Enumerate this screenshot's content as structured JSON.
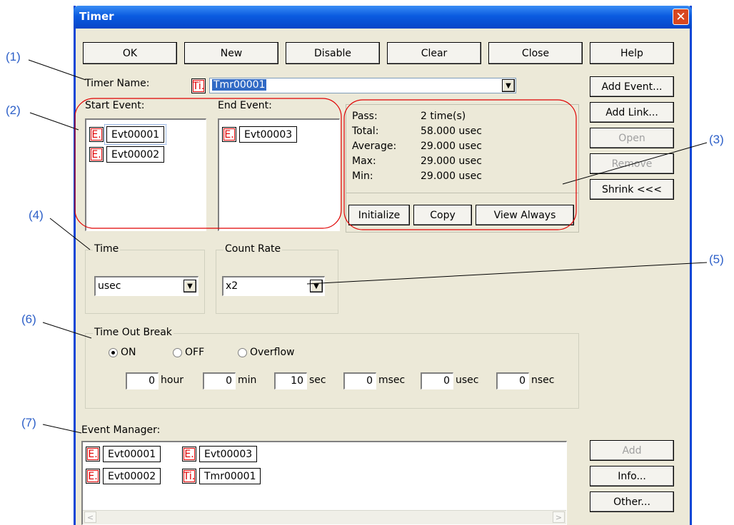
{
  "callouts": [
    "(1)",
    "(2)",
    "(3)",
    "(4)",
    "(5)",
    "(6)",
    "(7)"
  ],
  "window": {
    "title": "Timer"
  },
  "toolbar": {
    "ok": "OK",
    "new": "New",
    "disable": "Disable",
    "clear": "Clear",
    "close": "Close",
    "help": "Help"
  },
  "side_buttons": {
    "add_event": "Add Event...",
    "add_link": "Add Link...",
    "open": "Open",
    "remove": "Remove",
    "shrink": "Shrink <<<"
  },
  "timer_name": {
    "label": "Timer Name:",
    "badge": "Ti.",
    "value": "Tmr00001"
  },
  "start_event": {
    "label": "Start Event:",
    "items": [
      {
        "badge": "E.",
        "name": "Evt00001"
      },
      {
        "badge": "E.",
        "name": "Evt00002"
      }
    ]
  },
  "end_event": {
    "label": "End Event:",
    "items": [
      {
        "badge": "E.",
        "name": "Evt00003"
      }
    ]
  },
  "stats": {
    "pass_label": "Pass:",
    "pass_value": "2 time(s)",
    "total_label": "Total:",
    "total_value": "58.000 usec",
    "average_label": "Average:",
    "average_value": "29.000 usec",
    "max_label": "Max:",
    "max_value": "29.000 usec",
    "min_label": "Min:",
    "min_value": "29.000 usec",
    "initialize": "Initialize",
    "copy": "Copy",
    "view_always": "View Always"
  },
  "time_group": {
    "title": "Time",
    "value": "usec"
  },
  "count_rate": {
    "title": "Count Rate",
    "value": "x2"
  },
  "timeout": {
    "title": "Time Out Break",
    "options": [
      "ON",
      "OFF",
      "Overflow"
    ],
    "selected": "ON",
    "fields": [
      {
        "value": "0",
        "unit": "hour"
      },
      {
        "value": "0",
        "unit": "min"
      },
      {
        "value": "10",
        "unit": "sec"
      },
      {
        "value": "0",
        "unit": "msec"
      },
      {
        "value": "0",
        "unit": "usec"
      },
      {
        "value": "0",
        "unit": "nsec"
      }
    ]
  },
  "event_manager": {
    "label": "Event Manager:",
    "items": [
      {
        "badge": "E.",
        "name": "Evt00001"
      },
      {
        "badge": "E.",
        "name": "Evt00003"
      },
      {
        "badge": "E.",
        "name": "Evt00002"
      },
      {
        "badge": "Ti.",
        "name": "Tmr00001"
      }
    ]
  },
  "bottom_buttons": {
    "add": "Add",
    "info": "Info...",
    "other": "Other..."
  },
  "colors": {
    "callout": "#2c5fc8",
    "annotation_ring": "#e00000",
    "title_bar": "#0a5be0",
    "dialog_bg": "#ece9d8"
  }
}
